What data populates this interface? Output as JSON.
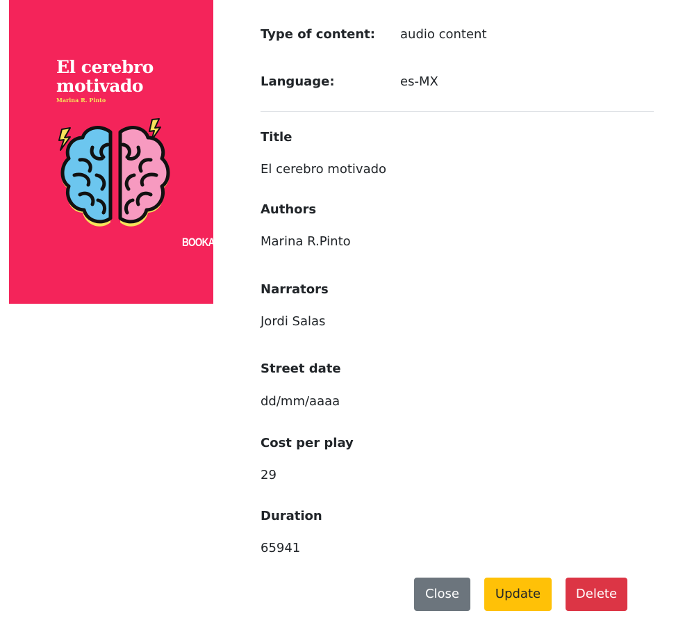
{
  "cover": {
    "title_line1": "El cerebro",
    "title_line2": "motivado",
    "author": "Marina R. Pinto",
    "publisher": "BOOKA",
    "background_color": "#f4245a"
  },
  "meta": {
    "type_label": "Type of content:",
    "type_value": "audio content",
    "language_label": "Language:",
    "language_value": "es-MX"
  },
  "fields": {
    "title_label": "Title",
    "title_value": "El cerebro motivado",
    "authors_label": "Authors",
    "authors_value": "Marina R.Pinto",
    "narrators_label": "Narrators",
    "narrators_value": "Jordi Salas",
    "street_date_label": "Street date",
    "street_date_value": "dd/mm/aaaa",
    "cost_label": "Cost per play",
    "cost_value": "29",
    "duration_label": "Duration",
    "duration_value": "65941"
  },
  "actions": {
    "close_label": "Close",
    "update_label": "Update",
    "delete_label": "Delete"
  }
}
